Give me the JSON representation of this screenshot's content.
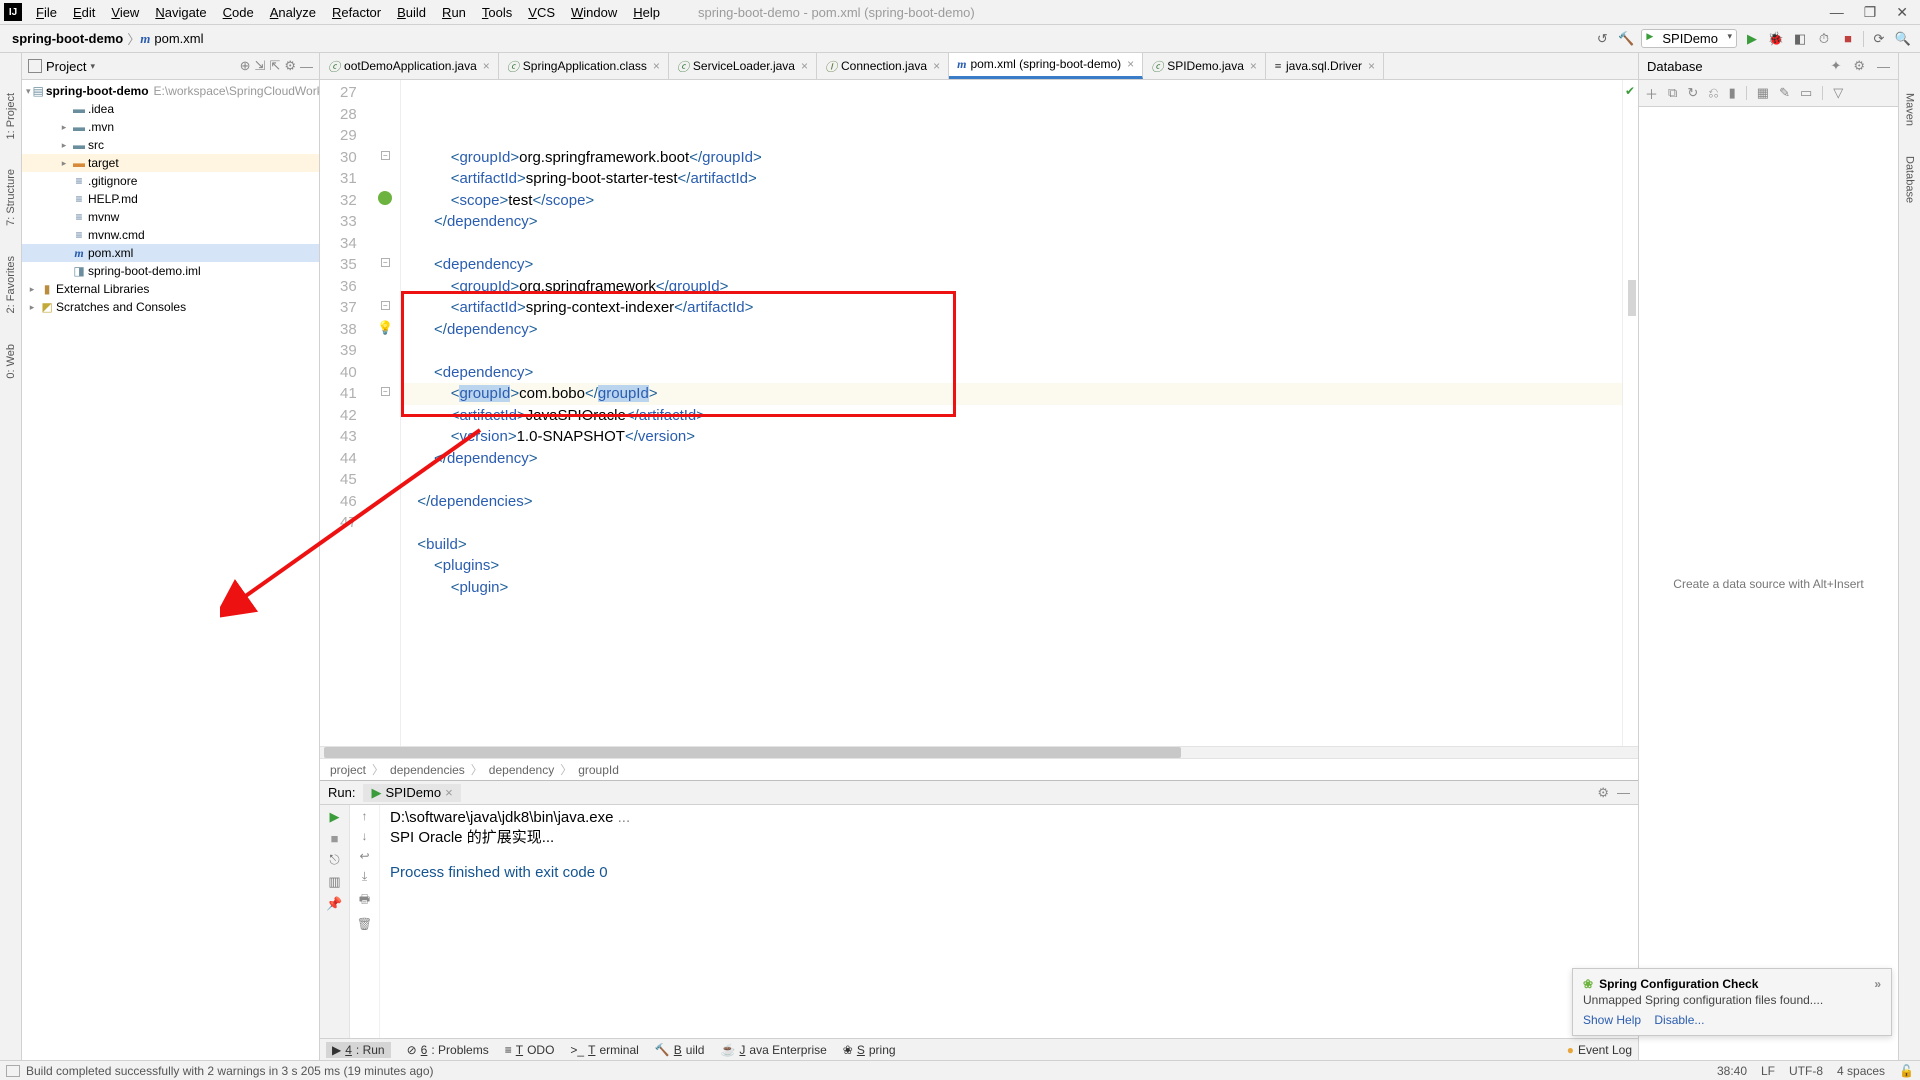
{
  "menubar": {
    "items": [
      "File",
      "Edit",
      "View",
      "Navigate",
      "Code",
      "Analyze",
      "Refactor",
      "Build",
      "Run",
      "Tools",
      "VCS",
      "Window",
      "Help"
    ],
    "title_muted": "spring-boot-demo - pom.xml (spring-boot-demo)"
  },
  "navbar": {
    "crumb1": "spring-boot-demo",
    "crumb2": "pom.xml",
    "run_config": "SPIDemo"
  },
  "project": {
    "header_label": "Project",
    "root_name": "spring-boot-demo",
    "root_path": "E:\\workspace\\SpringCloudWorkSpace",
    "children": [
      {
        "name": ".idea",
        "type": "dir",
        "indent": 2
      },
      {
        "name": ".mvn",
        "type": "dir",
        "indent": 2,
        "arrow": true
      },
      {
        "name": "src",
        "type": "dir",
        "indent": 2,
        "arrow": true
      },
      {
        "name": "target",
        "type": "dir-orange",
        "indent": 2,
        "arrow": true,
        "target": true
      },
      {
        "name": ".gitignore",
        "type": "file",
        "indent": 2
      },
      {
        "name": "HELP.md",
        "type": "md",
        "indent": 2
      },
      {
        "name": "mvnw",
        "type": "file",
        "indent": 2
      },
      {
        "name": "mvnw.cmd",
        "type": "file",
        "indent": 2
      },
      {
        "name": "pom.xml",
        "type": "pom",
        "indent": 2,
        "selected": true
      },
      {
        "name": "spring-boot-demo.iml",
        "type": "iml",
        "indent": 2
      }
    ],
    "external": "External Libraries",
    "scratches": "Scratches and Consoles"
  },
  "tabs": [
    {
      "label": "ootDemoApplication.java",
      "icon": "c",
      "partial": true
    },
    {
      "label": "SpringApplication.class",
      "icon": "c"
    },
    {
      "label": "ServiceLoader.java",
      "icon": "c"
    },
    {
      "label": "Connection.java",
      "icon": "i"
    },
    {
      "label": "pom.xml (spring-boot-demo)",
      "icon": "m",
      "active": true
    },
    {
      "label": "SPIDemo.java",
      "icon": "c"
    },
    {
      "label": "java.sql.Driver",
      "icon": "file"
    }
  ],
  "editor": {
    "first_line": 27,
    "caret_line_index": 11,
    "lines": [
      {
        "n": 27,
        "c": "            <groupId>org.springframework.boot</groupId>"
      },
      {
        "n": 28,
        "c": "            <artifactId>spring-boot-starter-test</artifactId>"
      },
      {
        "n": 29,
        "c": "            <scope>test</scope>"
      },
      {
        "n": 30,
        "c": "        </dependency>"
      },
      {
        "n": 31,
        "c": ""
      },
      {
        "n": 32,
        "c": "        <dependency>",
        "spring": true
      },
      {
        "n": 33,
        "c": "            <groupId>org.springframework</groupId>"
      },
      {
        "n": 34,
        "c": "            <artifactId>spring-context-indexer</artifactId>"
      },
      {
        "n": 35,
        "c": "        </dependency>"
      },
      {
        "n": 36,
        "c": ""
      },
      {
        "n": 37,
        "c": "        <dependency>"
      },
      {
        "n": 38,
        "c": "            <groupId>com.bobo</groupId>",
        "caret": true,
        "bulb": true
      },
      {
        "n": 39,
        "c": "            <artifactId>JavaSPIOracle</artifactId>"
      },
      {
        "n": 40,
        "c": "            <version>1.0-SNAPSHOT</version>"
      },
      {
        "n": 41,
        "c": "        </dependency>"
      },
      {
        "n": 42,
        "c": ""
      },
      {
        "n": 43,
        "c": "    </dependencies>"
      },
      {
        "n": 44,
        "c": ""
      },
      {
        "n": 45,
        "c": "    <build>"
      },
      {
        "n": 46,
        "c": "        <plugins>"
      },
      {
        "n": 47,
        "c": "            <plugin>"
      }
    ],
    "crumb": [
      "project",
      "dependencies",
      "dependency",
      "groupId"
    ]
  },
  "run": {
    "title": "Run:",
    "tab": "SPIDemo",
    "lines": [
      {
        "t": "D:\\software\\java\\jdk8\\bin\\java.exe ",
        "muted_suffix": "..."
      },
      {
        "t": "SPI Oracle 的扩展实现..."
      },
      {
        "t": ""
      },
      {
        "t": "Process finished with exit code 0",
        "blue": true
      }
    ]
  },
  "database": {
    "title": "Database",
    "placeholder": "Create a data source with Alt+Insert"
  },
  "notif": {
    "title": "Spring Configuration Check",
    "body": "Unmapped Spring configuration files found....",
    "link1": "Show Help",
    "link2": "Disable..."
  },
  "left_rail": [
    "1: Project",
    "7: Structure",
    "2: Favorites",
    "0: Web"
  ],
  "right_rail": [
    "Maven",
    "Database"
  ],
  "bottom_tools": {
    "items": [
      {
        "label": "4: Run",
        "active": true,
        "icon": "▶"
      },
      {
        "label": "6: Problems",
        "icon": "⊘"
      },
      {
        "label": "TODO",
        "icon": "≡"
      },
      {
        "label": "Terminal",
        "icon": ">_"
      },
      {
        "label": "Build",
        "icon": "🔨"
      },
      {
        "label": "Java Enterprise",
        "icon": "☕"
      },
      {
        "label": "Spring",
        "icon": "❀"
      }
    ],
    "event_log": "Event Log"
  },
  "statusbar": {
    "msg": "Build completed successfully with 2 warnings in 3 s 205 ms (19 minutes ago)",
    "pos": "38:40",
    "sep": "LF",
    "enc": "UTF-8",
    "indent": "4 spaces"
  }
}
